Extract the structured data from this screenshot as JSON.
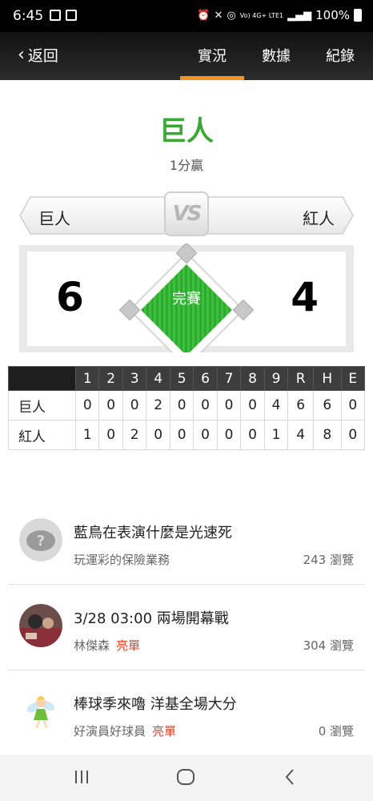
{
  "status": {
    "time": "6:45",
    "signal_text": "Vo) 4G+ LTE1",
    "battery": "100%"
  },
  "header": {
    "back_label": "返回",
    "tabs": [
      {
        "label": "實況",
        "active": true
      },
      {
        "label": "數據",
        "active": false
      },
      {
        "label": "紀錄",
        "active": false
      }
    ],
    "accent_color": "#f7941d"
  },
  "result": {
    "winner": "巨人",
    "margin": "1分贏",
    "winner_color": "#3aa835"
  },
  "matchup": {
    "home_team": "巨人",
    "away_team": "紅人",
    "vs_label": "VS",
    "home_score": "6",
    "away_score": "4",
    "status": "完賽"
  },
  "boxscore": {
    "headers": [
      "",
      "1",
      "2",
      "3",
      "4",
      "5",
      "6",
      "7",
      "8",
      "9",
      "R",
      "H",
      "E"
    ],
    "rows": [
      [
        "巨人",
        "0",
        "0",
        "0",
        "2",
        "0",
        "0",
        "0",
        "0",
        "4",
        "6",
        "6",
        "0"
      ],
      [
        "紅人",
        "1",
        "0",
        "2",
        "0",
        "0",
        "0",
        "0",
        "0",
        "1",
        "4",
        "8",
        "0"
      ]
    ]
  },
  "posts": [
    {
      "title": "藍鳥在表演什麼是光速死",
      "author": "玩運彩的保險業務",
      "badge": "",
      "views": "243 瀏覽",
      "avatar": "default-avatar-icon"
    },
    {
      "title": "3/28 03:00 兩場開幕戰",
      "author": "林傑森",
      "badge": "亮單",
      "views": "304 瀏覽",
      "avatar": "user-photo"
    },
    {
      "title": "棒球季來嚕 洋基全場大分",
      "author": "好演員好球員",
      "badge": "亮單",
      "views": "0 瀏覽",
      "avatar": "fairy-avatar"
    }
  ],
  "system_nav": {
    "recent": "recents-icon",
    "home": "home-icon",
    "back": "back-icon"
  }
}
